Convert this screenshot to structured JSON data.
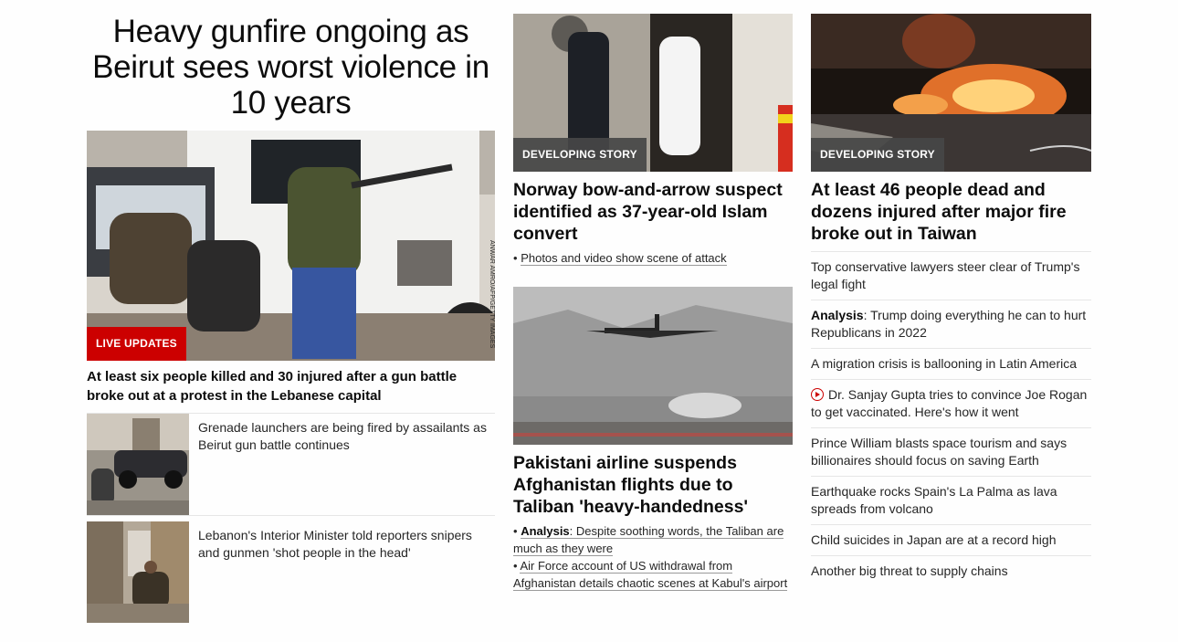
{
  "main": {
    "headline": "Heavy gunfire ongoing as Beirut sees worst violence in 10 years",
    "hero_badge": "LIVE UPDATES",
    "hero_credit": "ANWAR AMRO/AFP/GETTY IMAGES",
    "hero_title": "At least six people killed and 30 injured after a gun battle broke out at a protest in the Lebanese capital",
    "related": [
      {
        "text": "Grenade launchers are being fired by assailants as Beirut gun battle continues"
      },
      {
        "text": "Lebanon's Interior Minister told reporters snipers and gunmen 'shot people in the head'"
      }
    ]
  },
  "middle": {
    "story1": {
      "badge": "DEVELOPING STORY",
      "title": "Norway bow-and-arrow suspect identified as 37-year-old Islam convert",
      "links": [
        {
          "bullet": "•",
          "text": "Photos and video show scene of attack"
        }
      ]
    },
    "story2": {
      "title": "Pakistani airline suspends Afghanistan flights due to Taliban 'heavy-handedness'",
      "links": [
        {
          "bullet": "•",
          "prefix": "Analysis",
          "text": ": Despite soothing words, the Taliban are much as they were"
        },
        {
          "bullet": "•",
          "text": "Air Force account of US withdrawal from Afghanistan details chaotic scenes at Kabul's airport"
        }
      ]
    }
  },
  "right": {
    "badge": "DEVELOPING STORY",
    "title": "At least 46 people dead and dozens injured after major fire broke out in Taiwan",
    "list": [
      {
        "text": "Top conservative lawyers steer clear of Trump's legal fight"
      },
      {
        "prefix": "Analysis",
        "text": ": Trump doing everything he can to hurt Republicans in 2022"
      },
      {
        "text": "A migration crisis is ballooning in Latin America"
      },
      {
        "icon": "play-video-icon",
        "text": "Dr. Sanjay Gupta tries to convince Joe Rogan to get vaccinated. Here's how it went"
      },
      {
        "text": "Prince William blasts space tourism and says billionaires should focus on saving Earth"
      },
      {
        "text": "Earthquake rocks Spain's La Palma as lava spreads from volcano"
      },
      {
        "text": "Child suicides in Japan are at a record high"
      },
      {
        "text": "Another big threat to supply chains"
      }
    ]
  },
  "colors": {
    "live_red": "#cc0000",
    "badge_gray": "#464646",
    "text": "#0c0c0c",
    "divider": "#e6e6e6"
  }
}
